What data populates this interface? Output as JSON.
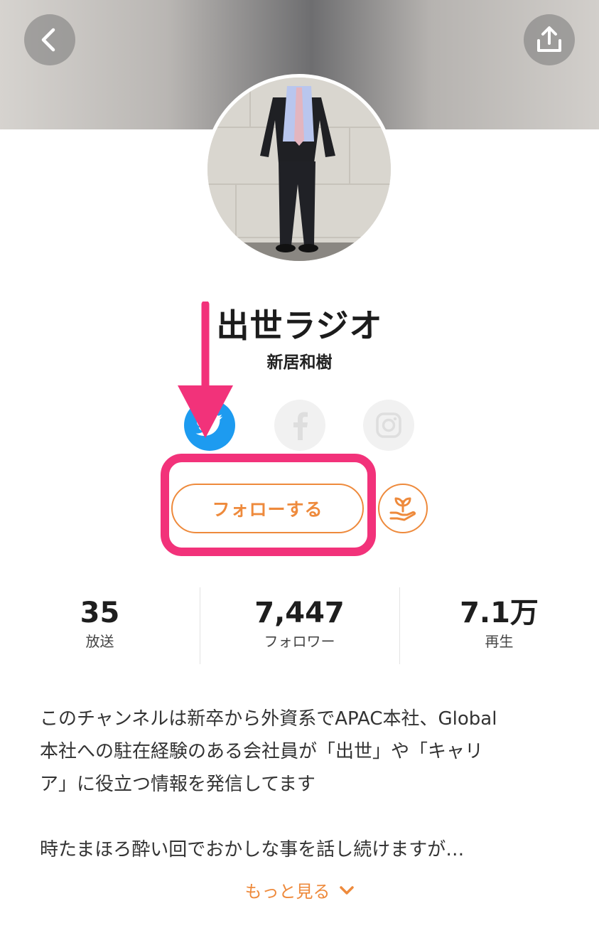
{
  "header": {
    "back_icon": "chevron-left-icon",
    "share_icon": "share-upload-icon"
  },
  "channel": {
    "title": "出世ラジオ",
    "owner": "新居和樹"
  },
  "social": {
    "twitter_icon": "twitter-icon",
    "facebook_icon": "facebook-icon",
    "instagram_icon": "instagram-icon"
  },
  "actions": {
    "follow_label": "フォローする",
    "gift_icon": "plant-hand-icon"
  },
  "stats": [
    {
      "value": "35",
      "label": "放送"
    },
    {
      "value": "7,447",
      "label": "フォロワー"
    },
    {
      "value": "7.1万",
      "label": "再生"
    }
  ],
  "description": {
    "lines": [
      "このチャンネルは新卒から外資系でAPAC本社、Global",
      "本社への駐在経験のある会社員が「出世」や「キャリ",
      "ア」に役立つ情報を発信してます",
      "",
      "時たまほろ酔い回でおかしな事を話し続けますが…"
    ]
  },
  "more": {
    "label": "もっと見る"
  },
  "colors": {
    "accent": "#ee8a3c",
    "highlight": "#f2327a",
    "twitter": "#1d9bf0"
  }
}
